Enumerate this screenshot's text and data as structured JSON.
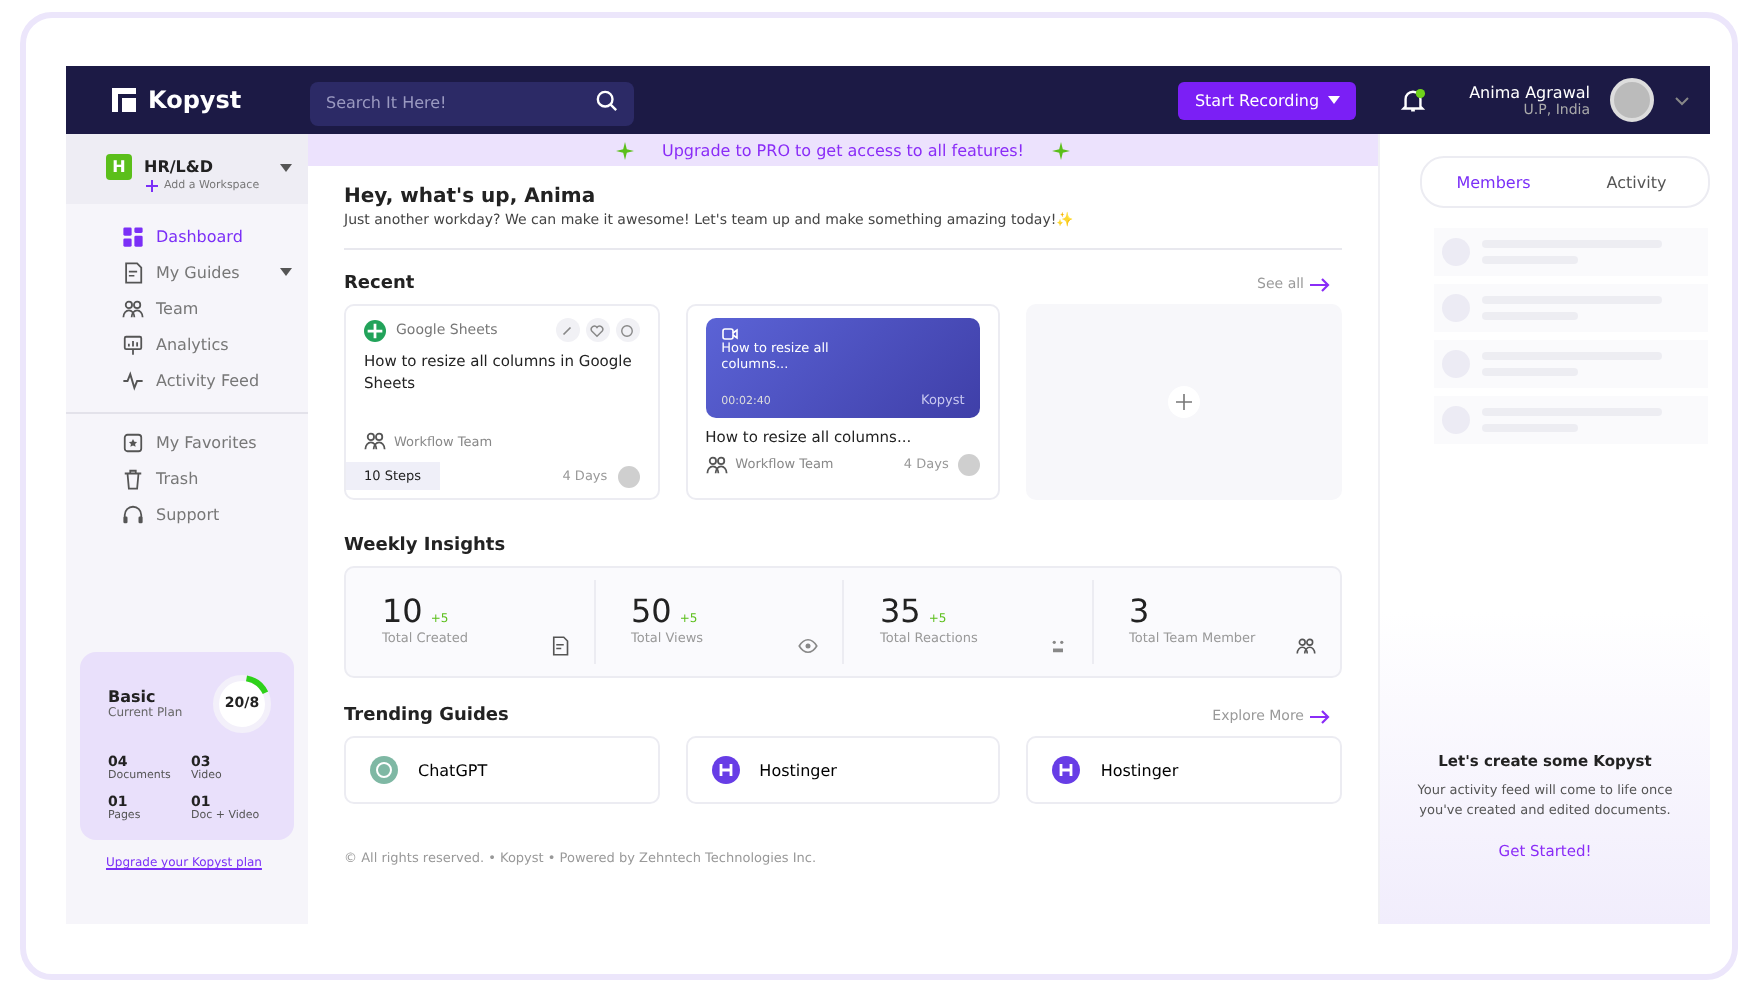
{
  "header": {
    "logo": "Kopyst",
    "search": {
      "placeholder": "Search It Here!"
    },
    "record_button": "Start Recording",
    "notification_dot": true,
    "user": {
      "name": "Anima Agrawal",
      "location": "U.P, India"
    }
  },
  "sidebar": {
    "workspace": {
      "badge": "H",
      "name": "HR/L&D",
      "add_label": "Add a Workspace"
    },
    "items": [
      {
        "label": "Dashboard",
        "selected": true,
        "has_caret": false
      },
      {
        "label": "My Guides",
        "selected": false,
        "has_caret": true
      },
      {
        "label": "Team",
        "selected": false,
        "has_caret": false
      },
      {
        "label": "Analytics",
        "selected": false,
        "has_caret": false
      },
      {
        "label": "Activity Feed",
        "selected": false,
        "has_caret": false
      }
    ],
    "secondary_items": [
      {
        "label": "My Favorites",
        "selected": false
      },
      {
        "label": "Trash",
        "selected": false
      },
      {
        "label": "Support",
        "selected": false
      }
    ],
    "plan": {
      "name": "Basic",
      "caption": "Current Plan",
      "ring_label": "20/8",
      "level": 0.15,
      "stats": [
        {
          "value": "04",
          "label": "Documents"
        },
        {
          "value": "03",
          "label": "Video"
        },
        {
          "value": "01",
          "label": "Pages"
        },
        {
          "value": "01",
          "label": "Doc + Video"
        }
      ]
    },
    "upgrade_link": "Upgrade your Kopyst plan"
  },
  "banner": "Upgrade to PRO to get access to all features!",
  "greeting": {
    "title": "Hey, what's up, Anima",
    "subtitle": "Just another workday? We can make it awesome! Let's team up and make something amazing today!✨"
  },
  "recent": {
    "title": "Recent",
    "see_all": "See all",
    "cards": [
      {
        "kind": "guide",
        "app": "Google Sheets",
        "title": "How to resize all columns in Google Sheets",
        "team": "Workflow Team",
        "steps": "10 Steps",
        "age": "4 Days"
      },
      {
        "kind": "video",
        "thumb_title": "How to resize all columns...",
        "duration": "00:02:40",
        "watermark": "Kopyst",
        "title": "How to resize all columns...",
        "team": "Workflow Team",
        "age": "4 Days"
      },
      {
        "kind": "add"
      }
    ]
  },
  "insights": {
    "title": "Weekly Insights",
    "items": [
      {
        "value": "10",
        "delta": "+5",
        "label": "Total Created"
      },
      {
        "value": "50",
        "delta": "+5",
        "label": "Total Views"
      },
      {
        "value": "35",
        "delta": "+5",
        "label": "Total Reactions"
      },
      {
        "value": "3",
        "label": "Total Team Member"
      }
    ]
  },
  "trending": {
    "title": "Trending Guides",
    "explore": "Explore More",
    "items": [
      {
        "name": "ChatGPT"
      },
      {
        "name": "Hostinger"
      },
      {
        "name": "Hostinger"
      }
    ]
  },
  "footer": "© All rights reserved. • Kopyst • Powered by Zehntech Technologies Inc.",
  "right_panel": {
    "tabs": [
      {
        "label": "Members",
        "selected": true
      },
      {
        "label": "Activity",
        "selected": false
      }
    ],
    "empty": {
      "title": "Let's create some Kopyst",
      "text": "Your activity feed will come to life once you've created and edited documents.",
      "link": "Get Started!"
    }
  }
}
